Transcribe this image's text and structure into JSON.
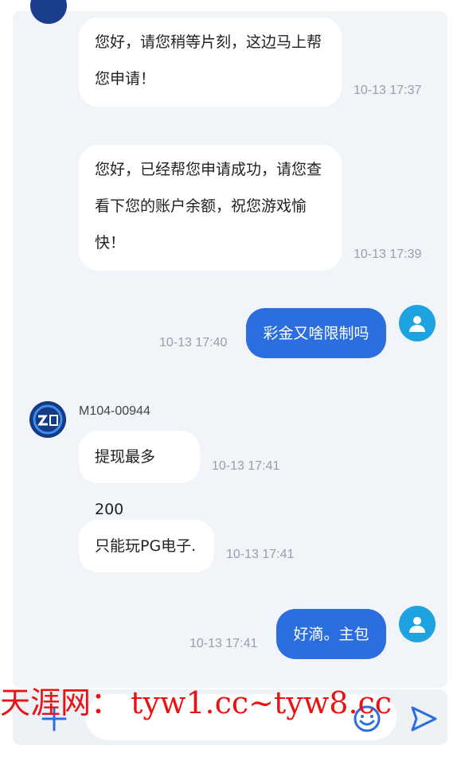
{
  "messages": [
    {
      "text_line1": "您好，请您稍等片刻，这边马上帮",
      "text_line2": "您申请！",
      "time": "10-13 17:37"
    },
    {
      "text_line1": "您好，已经帮您申请成功，请您查",
      "text_line2": "看下您的账户余额，祝您游戏愉",
      "text_line3": "快！",
      "time": "10-13 17:39"
    },
    {
      "text": "彩金又啥限制吗",
      "time": "10-13 17:40"
    },
    {
      "sender": "M104-00944",
      "text": "提现最多200",
      "time": "10-13 17:41"
    },
    {
      "text": "只能玩PG电子.",
      "time": "10-13 17:41"
    },
    {
      "text": "好滴。主包",
      "time": "10-13 17:41"
    }
  ],
  "watermark": "天涯网： tyw1.cc~tyw8.cc",
  "colors": {
    "accent": "#2b6ee0",
    "avatar": "#1fa3e0",
    "watermark": "#e81414"
  },
  "icons": [
    "plus-icon",
    "emoji-icon",
    "send-icon",
    "user-icon",
    "agent-logo-icon"
  ]
}
